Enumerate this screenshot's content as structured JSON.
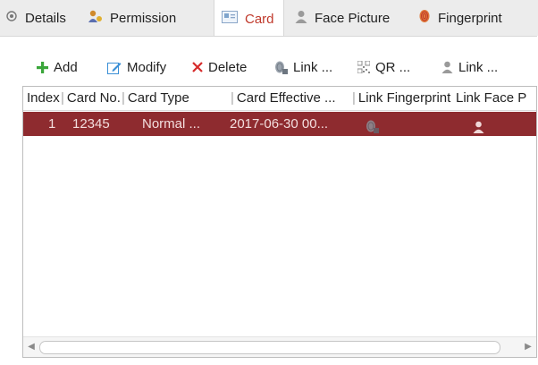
{
  "tabs": [
    {
      "label": "Details",
      "icon": "details-icon"
    },
    {
      "label": "Permission",
      "icon": "permission-icon"
    },
    {
      "label": "Card",
      "icon": "card-icon",
      "active": true
    },
    {
      "label": "Face Picture",
      "icon": "face-picture-icon"
    },
    {
      "label": "Fingerprint",
      "icon": "fingerprint-icon"
    }
  ],
  "toolbar": {
    "add_label": "Add",
    "modify_label": "Modify",
    "delete_label": "Delete",
    "link_fp_label": "Link ...",
    "qr_label": "QR ...",
    "link_face_label": "Link ..."
  },
  "table": {
    "columns": [
      "Index",
      "Card No.",
      "Card Type",
      "Card Effective ...",
      "Link Fingerprint",
      "Link Face P"
    ],
    "rows": [
      {
        "index": "1",
        "card_no": "12345",
        "card_type": "Normal ...",
        "effective": "2017-06-30 00...",
        "link_fingerprint_icon": "fingerprint-link-icon",
        "link_face_icon": "person-icon"
      }
    ]
  },
  "colors": {
    "selected_row": "#8e2b2f",
    "active_tab_text": "#c0392b",
    "add_icon": "#3aa63a",
    "delete_icon": "#d62b2b",
    "modify_icon": "#3a8fd6"
  }
}
